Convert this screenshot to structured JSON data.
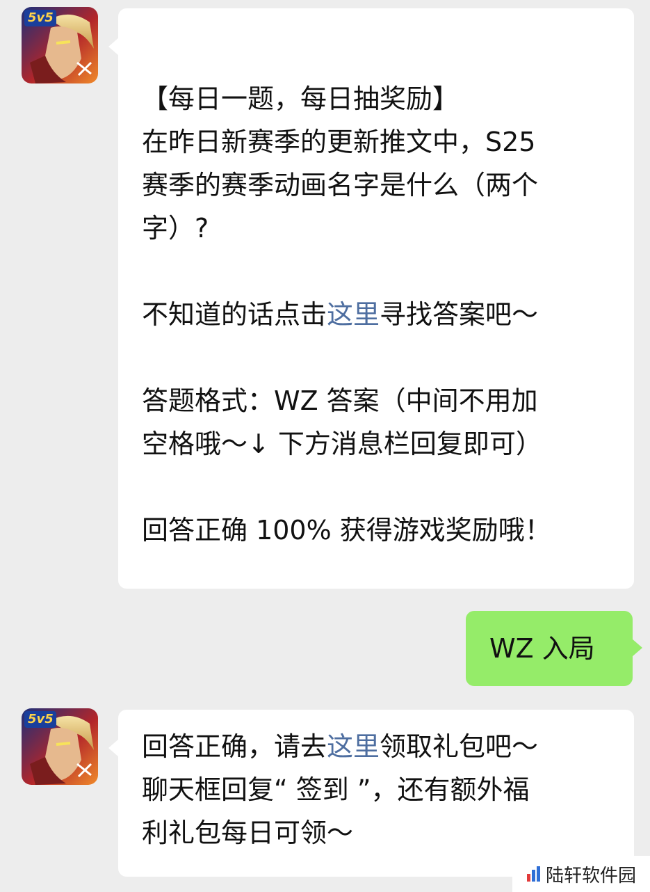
{
  "messages": {
    "m1": {
      "line1": "【每日一题，每日抽奖励】",
      "line2": "在昨日新赛季的更新推文中，S25",
      "line3": "赛季的赛季动画名字是什么（两个",
      "line4": "字）?",
      "line5_pre": "不知道的话点击",
      "line5_link": "这里",
      "line5_post": "寻找答案吧～",
      "line6": "答题格式：WZ 答案（中间不用加",
      "line7": "空格哦～↓ 下方消息栏回复即可）",
      "line8": "回答正确 100% 获得游戏奖励哦！"
    },
    "m2": {
      "text": "WZ 入局"
    },
    "m3": {
      "line1_pre": "回答正确，请去",
      "line1_link": "这里",
      "line1_post": "领取礼包吧～",
      "line2": "聊天框回复“ 签到 ”，还有额外福",
      "line3": "利礼包每日可领～"
    }
  },
  "avatar": {
    "badge": "5v5"
  },
  "watermark": {
    "text": "陆轩软件园"
  },
  "colors": {
    "background": "#ededed",
    "bubble_received": "#ffffff",
    "bubble_sent": "#95ec69",
    "link": "#4e6ea0"
  }
}
